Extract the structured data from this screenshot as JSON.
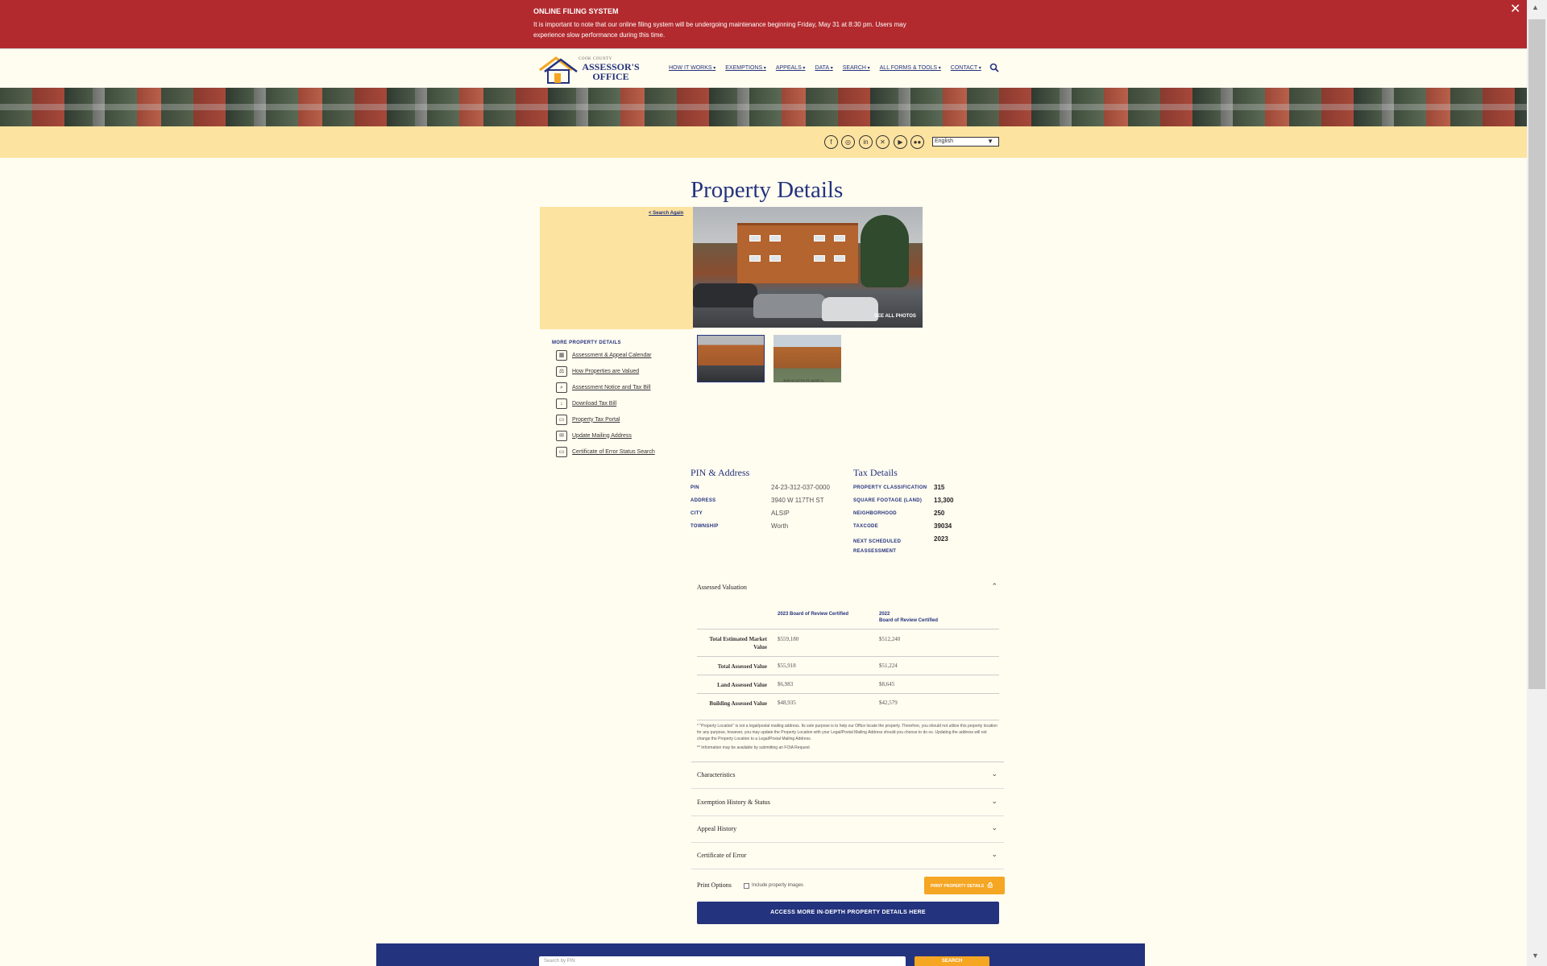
{
  "alert": {
    "title": "ONLINE FILING SYSTEM",
    "body": "It is important to note that our online filing system will be undergoing maintenance beginning Friday, May 31 at 8:30 pm. Users may experience slow performance during this time.",
    "close": "✕"
  },
  "logo": {
    "small": "COOK COUNTY",
    "line1": "ASSESSOR'S",
    "line2": "OFFICE"
  },
  "nav": {
    "items": [
      "HOW IT WORKS",
      "EXEMPTIONS",
      "APPEALS",
      "DATA",
      "SEARCH",
      "ALL FORMS & TOOLS",
      "CONTACT"
    ]
  },
  "social": {
    "icons": [
      "facebook-icon",
      "instagram-icon",
      "linkedin-icon",
      "x-icon",
      "youtube-icon",
      "flickr-icon"
    ],
    "glyphs": [
      "f",
      "◎",
      "in",
      "✕",
      "▶",
      "●●"
    ],
    "language": "English"
  },
  "page": {
    "title": "Property Details",
    "search_again": "< Search Again",
    "see_all_photos": "SEE ALL PHOTOS",
    "thumb_caption": "3940 W 117TH ST, ALSIP, IL"
  },
  "more_details": {
    "title": "MORE PROPERTY DETAILS",
    "links": [
      {
        "label": "Assessment & Appeal Calendar",
        "icon": "calendar-icon",
        "glyph": "▦"
      },
      {
        "label": "How Properties are Valued",
        "icon": "scale-icon",
        "glyph": "⚖"
      },
      {
        "label": "Assessment Notice and Tax Bill",
        "icon": "document-search-icon",
        "glyph": "⌕"
      },
      {
        "label": "Download Tax Bill",
        "icon": "download-icon",
        "glyph": "↓"
      },
      {
        "label": "Property Tax Portal",
        "icon": "window-icon",
        "glyph": "▭"
      },
      {
        "label": "Update Mailing Address",
        "icon": "address-card-icon",
        "glyph": "✉"
      },
      {
        "label": "Certificate of Error Status Search",
        "icon": "window-icon",
        "glyph": "▭"
      }
    ]
  },
  "pin_address": {
    "heading": "PIN & Address",
    "rows": [
      {
        "label": "PIN",
        "value": "24-23-312-037-0000"
      },
      {
        "label": "ADDRESS",
        "value": "3940 W 117TH ST"
      },
      {
        "label": "CITY",
        "value": "ALSIP"
      },
      {
        "label": "TOWNSHIP",
        "value": "Worth"
      }
    ]
  },
  "tax_details": {
    "heading": "Tax Details",
    "rows": [
      {
        "label": "PROPERTY CLASSIFICATION",
        "value": "315"
      },
      {
        "label": "SQUARE FOOTAGE (LAND)",
        "value": "13,300"
      },
      {
        "label": "NEIGHBORHOOD",
        "value": "250"
      },
      {
        "label": "TAXCODE",
        "value": "39034"
      },
      {
        "label": "NEXT SCHEDULED REASSESSMENT",
        "value": "2023"
      }
    ]
  },
  "valuation": {
    "heading": "Assessed Valuation",
    "col1": "2023 Board of Review Certified",
    "col2_year": "2022",
    "col2": "Board of Review Certified",
    "rows": [
      {
        "label": "Total Estimated Market Value",
        "v1": "$559,180",
        "v2": "$512,240"
      },
      {
        "label": "Total Assessed Value",
        "v1": "$55,918",
        "v2": "$51,224"
      },
      {
        "label": "Land Assessed Value",
        "v1": "$6,983",
        "v2": "$8,645"
      },
      {
        "label": "Building Assessed Value",
        "v1": "$48,935",
        "v2": "$42,579"
      }
    ],
    "footnote1": "* \"Property Location\" is not a legal/postal mailing address. Its sole purpose is to help our Office locate the property. Therefore, you should not utilize this property location for any purpose, however, you may update the Property Location with your Legal/Postal Mailing Address should you choose to do so. Updating the address will not change the Property Location to a Legal/Postal Mailing Address.",
    "footnote2": "** Information may be available by submitting an FOIA Request"
  },
  "accordions": [
    "Characteristics",
    "Exemption History & Status",
    "Appeal History",
    "Certificate of Error"
  ],
  "print": {
    "label": "Print Options",
    "checkbox_label": "Include property images",
    "button": "PRINT PROPERTY DETAILS"
  },
  "access_button": "ACCESS MORE IN-DEPTH PROPERTY DETAILS HERE",
  "footer": {
    "placeholder": "Search by PIN",
    "button": "SEARCH"
  }
}
